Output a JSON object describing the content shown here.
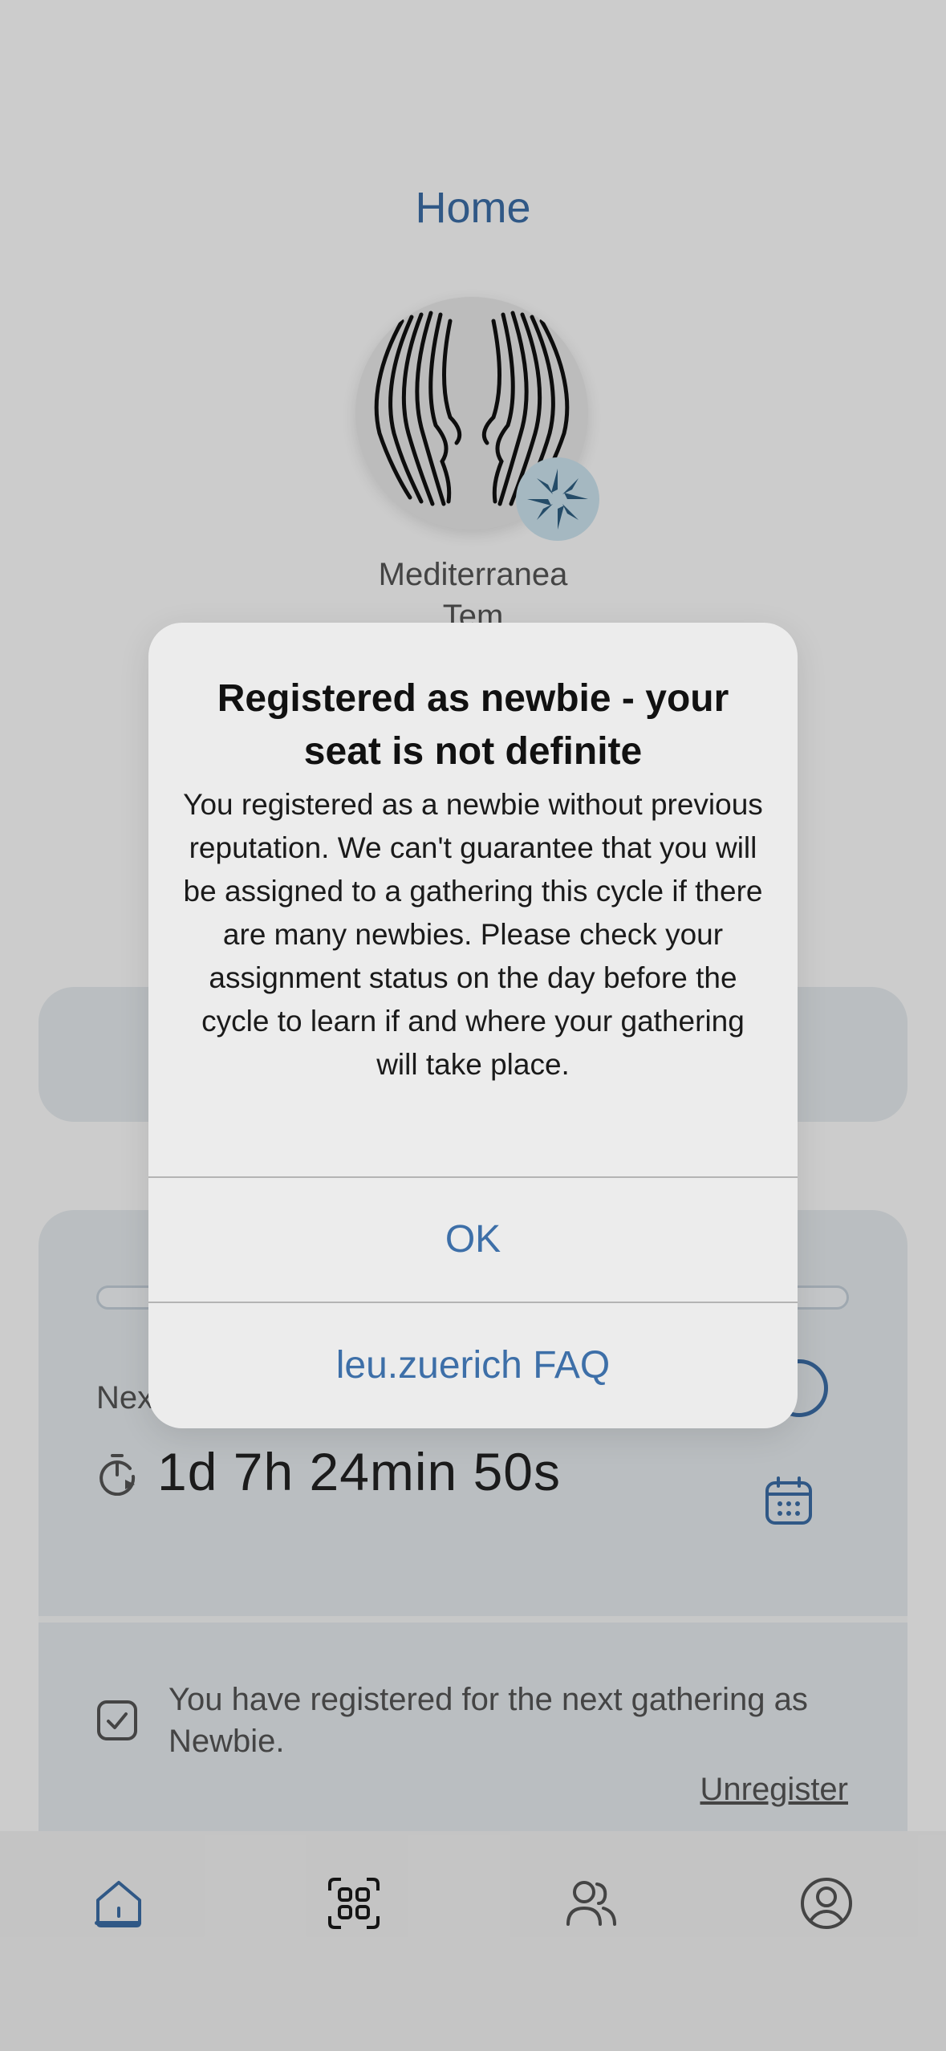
{
  "header": {
    "title": "Home"
  },
  "community": {
    "name": "Mediterranea",
    "name_cut": "Tem"
  },
  "ceremony": {
    "next_label": "Nex",
    "countdown": "1d 7h 24min 50s",
    "registered_text": "You have registered for the next gathering as Newbie.",
    "unregister_label": "Unregister"
  },
  "alert": {
    "title": "Registered as newbie - your seat is not definite",
    "message": "You registered as a newbie without previous reputation. We can't guarantee that you will be assigned to a gathering this cycle if there are many newbies. Please check your assignment status on the day before the cycle to learn if and where your gathering will take place.",
    "ok_label": "OK",
    "faq_label": "leu.zuerich FAQ"
  },
  "bottom_nav": {
    "items": [
      {
        "icon": "home-icon",
        "active": true
      },
      {
        "icon": "scan-icon",
        "active": false
      },
      {
        "icon": "contacts-icon",
        "active": false
      },
      {
        "icon": "profile-icon",
        "active": false
      }
    ]
  },
  "colors": {
    "accent": "#3d6fa8",
    "overlay": "rgba(0,0,0,0.2)",
    "alert_bg": "#ececec"
  }
}
